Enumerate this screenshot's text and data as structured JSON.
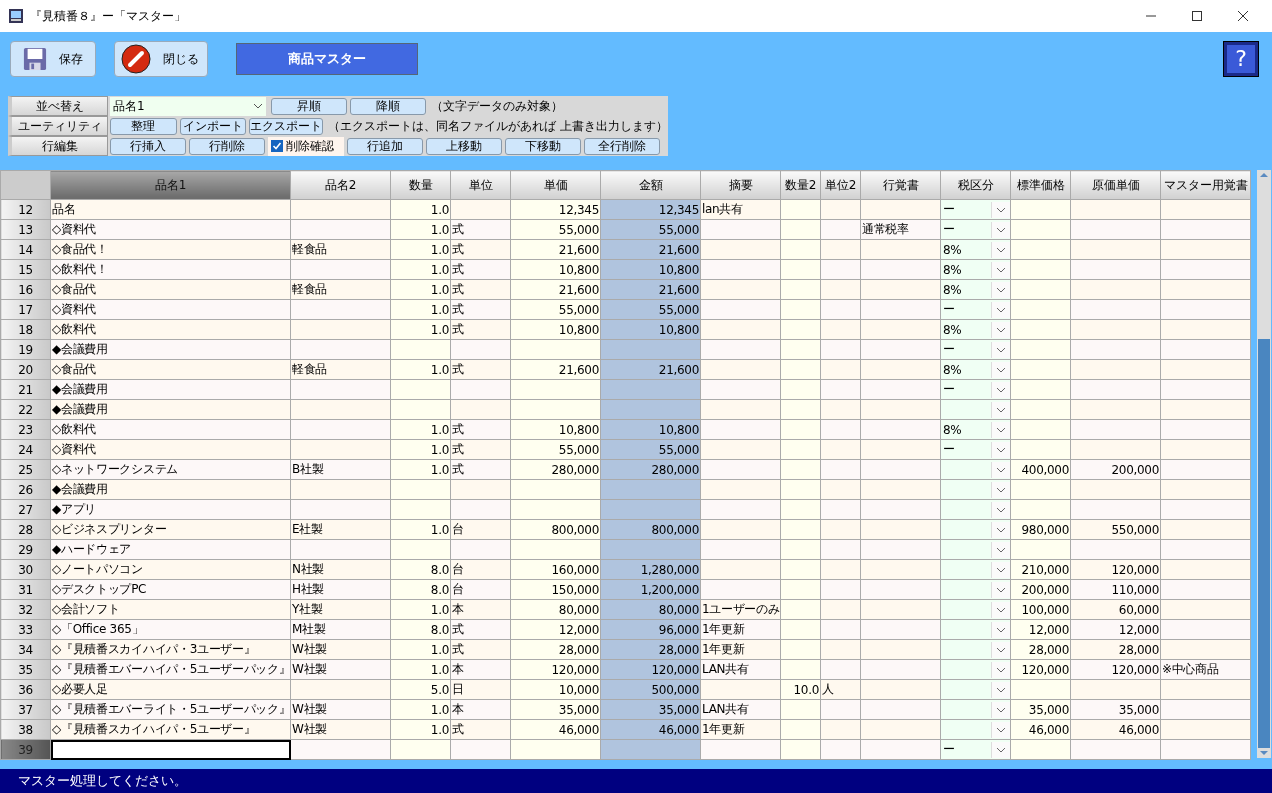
{
  "window": {
    "title": "『見積番８』ー「マスター」"
  },
  "toolbar": {
    "buttons": [
      {
        "kind": "save",
        "label": "保存"
      },
      {
        "kind": "close",
        "label": "閉じる"
      }
    ],
    "screen_title": "商品マスター",
    "help_label": "?"
  },
  "controls": {
    "sort": {
      "label": "並べ替え",
      "field": "品名1",
      "buttons": [
        "昇順",
        "降順"
      ],
      "note": "（文字データのみ対象）"
    },
    "utility": {
      "label": "ユーティリティ",
      "buttons": [
        "整理",
        "インポート",
        "エクスポート"
      ],
      "note": "（エクスポートは、同名ファイルがあれば 上書き出力します）"
    },
    "row_edit": {
      "label": "行編集",
      "buttons_before": [
        "行挿入",
        "行削除"
      ],
      "checkbox": {
        "label": "削除確認",
        "checked": true
      },
      "buttons_after": [
        "行追加",
        "上移動",
        "下移動",
        "全行削除"
      ]
    }
  },
  "table": {
    "columns": [
      {
        "label": "品名1",
        "kind": "text",
        "sorted": true
      },
      {
        "label": "品名2",
        "kind": "text",
        "sorted": false
      },
      {
        "label": "数量",
        "kind": "number",
        "sorted": false
      },
      {
        "label": "単位",
        "kind": "text",
        "sorted": false
      },
      {
        "label": "単価",
        "kind": "number",
        "sorted": false
      },
      {
        "label": "金額",
        "kind": "number",
        "sorted": false
      },
      {
        "label": "摘要",
        "kind": "text",
        "sorted": false
      },
      {
        "label": "数量2",
        "kind": "number",
        "sorted": false
      },
      {
        "label": "単位2",
        "kind": "text",
        "sorted": false
      },
      {
        "label": "行覚書",
        "kind": "text",
        "sorted": false
      },
      {
        "label": "税区分",
        "kind": "select",
        "sorted": false
      },
      {
        "label": "標準価格",
        "kind": "number",
        "sorted": false
      },
      {
        "label": "原価単価",
        "kind": "number",
        "sorted": false
      },
      {
        "label": "マスター用覚書",
        "kind": "text",
        "sorted": false
      }
    ],
    "rows": [
      {
        "number": "12",
        "selected": false,
        "cells": [
          "品名",
          null,
          "1.0",
          null,
          "12,345",
          "12,345",
          "lan共有",
          null,
          null,
          null,
          "ー",
          null,
          null,
          null
        ]
      },
      {
        "number": "13",
        "selected": false,
        "cells": [
          "◇資料代",
          null,
          "1.0",
          "式",
          "55,000",
          "55,000",
          null,
          null,
          null,
          "通常税率",
          "ー",
          null,
          null,
          null
        ]
      },
      {
        "number": "14",
        "selected": false,
        "cells": [
          "◇食品代！",
          "軽食品",
          "1.0",
          "式",
          "21,600",
          "21,600",
          null,
          null,
          null,
          null,
          "8%",
          null,
          null,
          null
        ]
      },
      {
        "number": "15",
        "selected": false,
        "cells": [
          "◇飲料代！",
          null,
          "1.0",
          "式",
          "10,800",
          "10,800",
          null,
          null,
          null,
          null,
          "8%",
          null,
          null,
          null
        ]
      },
      {
        "number": "16",
        "selected": false,
        "cells": [
          "◇食品代",
          "軽食品",
          "1.0",
          "式",
          "21,600",
          "21,600",
          null,
          null,
          null,
          null,
          "8%",
          null,
          null,
          null
        ]
      },
      {
        "number": "17",
        "selected": false,
        "cells": [
          "◇資料代",
          null,
          "1.0",
          "式",
          "55,000",
          "55,000",
          null,
          null,
          null,
          null,
          "ー",
          null,
          null,
          null
        ]
      },
      {
        "number": "18",
        "selected": false,
        "cells": [
          "◇飲料代",
          null,
          "1.0",
          "式",
          "10,800",
          "10,800",
          null,
          null,
          null,
          null,
          "8%",
          null,
          null,
          null
        ]
      },
      {
        "number": "19",
        "selected": false,
        "cells": [
          "◆会議費用",
          null,
          null,
          null,
          null,
          null,
          null,
          null,
          null,
          null,
          "ー",
          null,
          null,
          null
        ]
      },
      {
        "number": "20",
        "selected": false,
        "cells": [
          "◇食品代",
          "軽食品",
          "1.0",
          "式",
          "21,600",
          "21,600",
          null,
          null,
          null,
          null,
          "8%",
          null,
          null,
          null
        ]
      },
      {
        "number": "21",
        "selected": false,
        "cells": [
          "◆会議費用",
          null,
          null,
          null,
          null,
          null,
          null,
          null,
          null,
          null,
          "ー",
          null,
          null,
          null
        ]
      },
      {
        "number": "22",
        "selected": false,
        "cells": [
          "◆会議費用",
          null,
          null,
          null,
          null,
          null,
          null,
          null,
          null,
          null,
          null,
          null,
          null,
          null
        ]
      },
      {
        "number": "23",
        "selected": false,
        "cells": [
          "◇飲料代",
          null,
          "1.0",
          "式",
          "10,800",
          "10,800",
          null,
          null,
          null,
          null,
          "8%",
          null,
          null,
          null
        ]
      },
      {
        "number": "24",
        "selected": false,
        "cells": [
          "◇資料代",
          null,
          "1.0",
          "式",
          "55,000",
          "55,000",
          null,
          null,
          null,
          null,
          "ー",
          null,
          null,
          null
        ]
      },
      {
        "number": "25",
        "selected": false,
        "cells": [
          "◇ネットワークシステム",
          "B社製",
          "1.0",
          "式",
          "280,000",
          "280,000",
          null,
          null,
          null,
          null,
          null,
          "400,000",
          "200,000",
          null
        ]
      },
      {
        "number": "26",
        "selected": false,
        "cells": [
          "◆会議費用",
          null,
          null,
          null,
          null,
          null,
          null,
          null,
          null,
          null,
          null,
          null,
          null,
          null
        ]
      },
      {
        "number": "27",
        "selected": false,
        "cells": [
          "◆アプリ",
          null,
          null,
          null,
          null,
          null,
          null,
          null,
          null,
          null,
          null,
          null,
          null,
          null
        ]
      },
      {
        "number": "28",
        "selected": false,
        "cells": [
          "◇ビジネスプリンター",
          "E社製",
          "1.0",
          "台",
          "800,000",
          "800,000",
          null,
          null,
          null,
          null,
          null,
          "980,000",
          "550,000",
          null
        ]
      },
      {
        "number": "29",
        "selected": false,
        "cells": [
          "◆ハードウェア",
          null,
          null,
          null,
          null,
          null,
          null,
          null,
          null,
          null,
          null,
          null,
          null,
          null
        ]
      },
      {
        "number": "30",
        "selected": false,
        "cells": [
          "◇ノートパソコン",
          "N社製",
          "8.0",
          "台",
          "160,000",
          "1,280,000",
          null,
          null,
          null,
          null,
          null,
          "210,000",
          "120,000",
          null
        ]
      },
      {
        "number": "31",
        "selected": false,
        "cells": [
          "◇デスクトップPC",
          "H社製",
          "8.0",
          "台",
          "150,000",
          "1,200,000",
          null,
          null,
          null,
          null,
          null,
          "200,000",
          "110,000",
          null
        ]
      },
      {
        "number": "32",
        "selected": false,
        "cells": [
          "◇会計ソフト",
          "Y社製",
          "1.0",
          "本",
          "80,000",
          "80,000",
          "1ユーザーのみ",
          null,
          null,
          null,
          null,
          "100,000",
          "60,000",
          null
        ]
      },
      {
        "number": "33",
        "selected": false,
        "cells": [
          "◇「Office 365」",
          "M社製",
          "8.0",
          "式",
          "12,000",
          "96,000",
          "1年更新",
          null,
          null,
          null,
          null,
          "12,000",
          "12,000",
          null
        ]
      },
      {
        "number": "34",
        "selected": false,
        "cells": [
          "◇『見積番スカイハイパ・3ユーザー』",
          "W社製",
          "1.0",
          "式",
          "28,000",
          "28,000",
          "1年更新",
          null,
          null,
          null,
          null,
          "28,000",
          "28,000",
          null
        ]
      },
      {
        "number": "35",
        "selected": false,
        "cells": [
          "◇『見積番エバーハイパ・5ユーザーパック』",
          "W社製",
          "1.0",
          "本",
          "120,000",
          "120,000",
          "LAN共有",
          null,
          null,
          null,
          null,
          "120,000",
          "120,000",
          "※中心商品"
        ]
      },
      {
        "number": "36",
        "selected": false,
        "cells": [
          "◇必要人足",
          null,
          "5.0",
          "日",
          "10,000",
          "500,000",
          null,
          "10.0",
          "人",
          null,
          null,
          null,
          null,
          null
        ]
      },
      {
        "number": "37",
        "selected": false,
        "cells": [
          "◇『見積番エバーライト・5ユーザーパック』",
          "W社製",
          "1.0",
          "本",
          "35,000",
          "35,000",
          "LAN共有",
          null,
          null,
          null,
          null,
          "35,000",
          "35,000",
          null
        ]
      },
      {
        "number": "38",
        "selected": false,
        "cells": [
          "◇『見積番スカイハイパ・5ユーザー』",
          "W社製",
          "1.0",
          "式",
          "46,000",
          "46,000",
          "1年更新",
          null,
          null,
          null,
          null,
          "46,000",
          "46,000",
          null
        ]
      },
      {
        "number": "39",
        "selected": true,
        "cells": [
          null,
          null,
          null,
          null,
          null,
          null,
          null,
          null,
          null,
          null,
          "ー",
          null,
          null,
          null
        ]
      }
    ]
  },
  "status_bar": {
    "message": "マスター処理してください。"
  }
}
